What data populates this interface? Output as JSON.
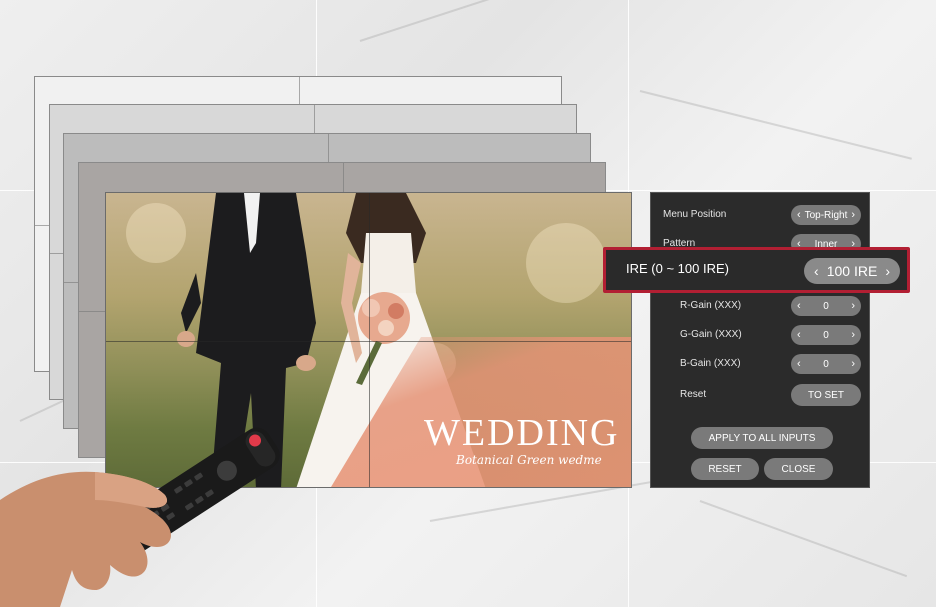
{
  "screen": {
    "title": "WEDDING",
    "subtitle": "Botanical Green wedme"
  },
  "panel": {
    "menu_position": {
      "label": "Menu Position",
      "value": "Top-Right"
    },
    "pattern": {
      "label": "Pattern",
      "value": "Inner"
    },
    "ire": {
      "label": "IRE (0 ~ 100 IRE)",
      "value": "100 IRE"
    },
    "r_gain": {
      "label": "R-Gain (XXX)",
      "value": "0"
    },
    "g_gain": {
      "label": "G-Gain (XXX)",
      "value": "0"
    },
    "b_gain": {
      "label": "B-Gain (XXX)",
      "value": "0"
    },
    "reset_row": {
      "label": "Reset",
      "value": "TO SET"
    },
    "apply_all": "APPLY TO ALL INPUTS",
    "reset_button": "RESET",
    "close_button": "CLOSE"
  },
  "colors": {
    "highlight_border": "#b21f33",
    "panel_bg": "#2b2b2b",
    "pill_bg": "#7a7a7a"
  }
}
